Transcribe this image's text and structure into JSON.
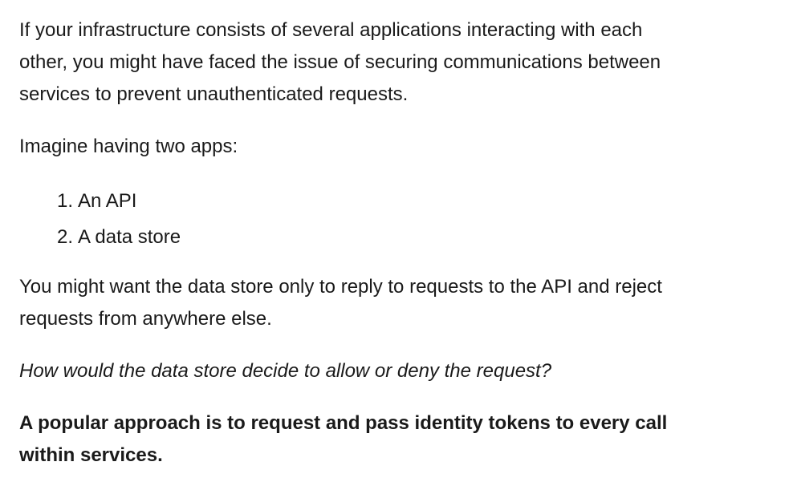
{
  "article": {
    "paragraph_1_line_1": "If your infrastructure consists of several applications interacting with each",
    "paragraph_1_line_2": "other, you might have faced the issue of securing communications between",
    "paragraph_1_line_3": "services to prevent unauthenticated requests.",
    "paragraph_2": "Imagine having two apps:",
    "list": [
      {
        "number": "1.",
        "text": "An API"
      },
      {
        "number": "2.",
        "text": "A data store"
      }
    ],
    "paragraph_3_line_1": "You might want the data store only to reply to requests to the API and reject",
    "paragraph_3_line_2": "requests from anywhere else.",
    "paragraph_4": "How would the data store decide to allow or deny the request?",
    "paragraph_5_line_1": "A popular approach is to request and pass identity tokens to every call",
    "paragraph_5_line_2": "within services."
  }
}
